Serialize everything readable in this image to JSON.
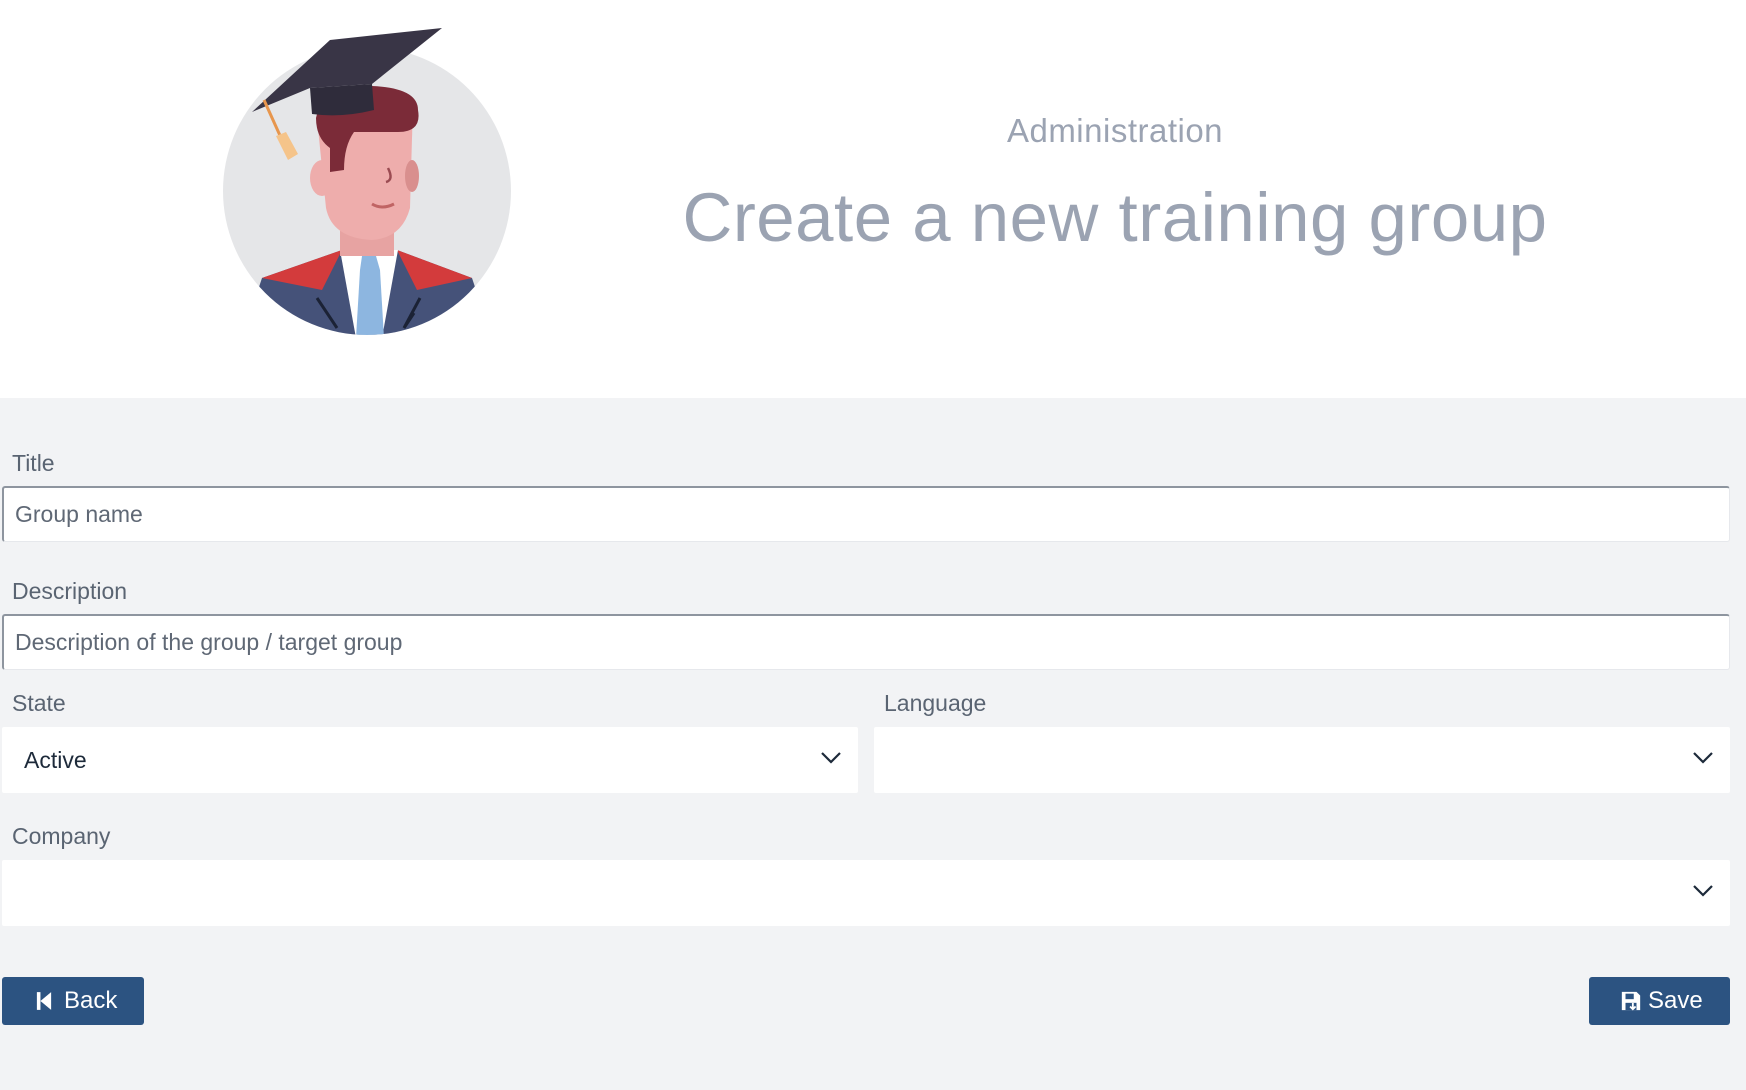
{
  "header": {
    "section": "Administration",
    "title": "Create a new training group",
    "avatar_icon": "graduate-avatar-icon"
  },
  "form": {
    "title_field": {
      "label": "Title",
      "value": "",
      "placeholder": "Group name"
    },
    "description_field": {
      "label": "Description",
      "value": "",
      "placeholder": "Description of the group / target group"
    },
    "state_field": {
      "label": "State",
      "selected": "Active"
    },
    "language_field": {
      "label": "Language",
      "selected": ""
    },
    "company_field": {
      "label": "Company",
      "selected": ""
    }
  },
  "actions": {
    "back_label": "Back",
    "back_icon": "step-backward-icon",
    "save_label": "Save",
    "save_icon": "save-icon"
  },
  "colors": {
    "primary_button": "#2c5381",
    "form_background": "#f2f3f5",
    "heading_text": "#9ba3b2"
  }
}
